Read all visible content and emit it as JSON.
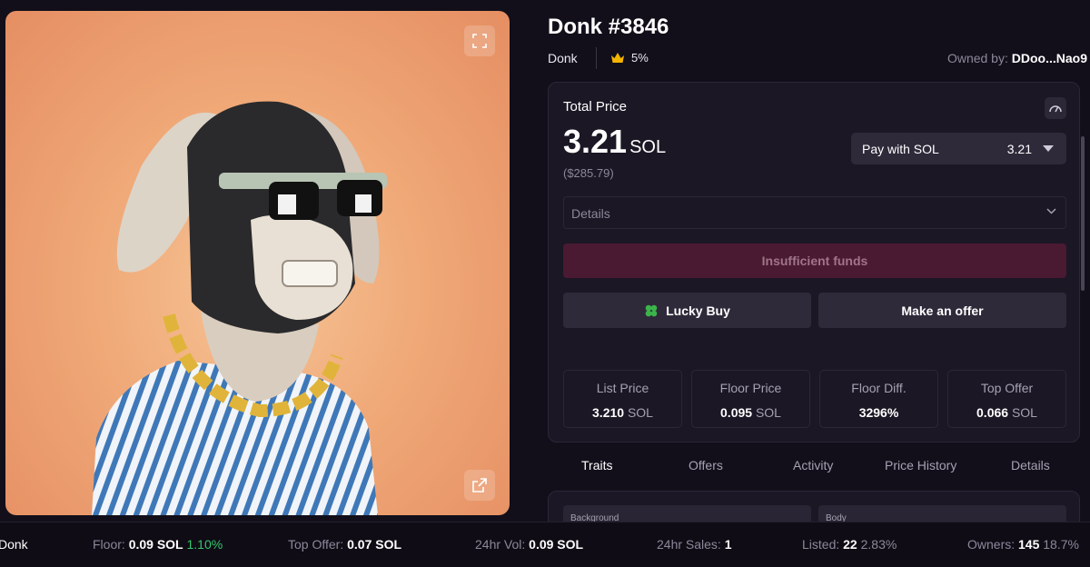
{
  "nft": {
    "title": "Donk #3846",
    "collection": "Donk",
    "royalty": "5%",
    "owner_label": "Owned by:",
    "owner_value": "DDoo...Nao9"
  },
  "price": {
    "total_label": "Total Price",
    "amount": "3.21",
    "currency": "SOL",
    "usd": "($285.79)",
    "pay_with_label": "Pay with SOL",
    "pay_with_amount": "3.21",
    "details_label": "Details",
    "insufficient_label": "Insufficient funds",
    "lucky_buy_label": "Lucky Buy",
    "make_offer_label": "Make an offer"
  },
  "stats": [
    {
      "label": "List Price",
      "value": "3.210",
      "unit": "SOL"
    },
    {
      "label": "Floor Price",
      "value": "0.095",
      "unit": "SOL"
    },
    {
      "label": "Floor Diff.",
      "value": "3296%",
      "unit": ""
    },
    {
      "label": "Top Offer",
      "value": "0.066",
      "unit": "SOL"
    }
  ],
  "tabs": [
    "Traits",
    "Offers",
    "Activity",
    "Price History",
    "Details"
  ],
  "traits": [
    "Background",
    "Body"
  ],
  "bottom_bar": {
    "collection": "Donk",
    "floor_label": "Floor:",
    "floor_value": "0.09",
    "floor_unit": "SOL",
    "floor_change": "1.10%",
    "top_offer_label": "Top Offer:",
    "top_offer_value": "0.07",
    "top_offer_unit": "SOL",
    "vol_label": "24hr Vol:",
    "vol_value": "0.09",
    "vol_unit": "SOL",
    "sales_label": "24hr Sales:",
    "sales_value": "1",
    "listed_label": "Listed:",
    "listed_value": "22",
    "listed_pct": "2.83%",
    "owners_label": "Owners:",
    "owners_value": "145",
    "owners_pct": "18.7%"
  },
  "icons": {
    "expand": "expand-icon",
    "external": "external-link-icon",
    "crown": "crown-icon",
    "gauge": "gauge-icon",
    "clover": "clover-icon",
    "chevron": "chevron-down-icon"
  },
  "colors": {
    "background": "#120f1a",
    "card": "#1b1724",
    "insufficient": "#4a1932",
    "positive": "#36c76e",
    "crown": "#f5b400"
  }
}
